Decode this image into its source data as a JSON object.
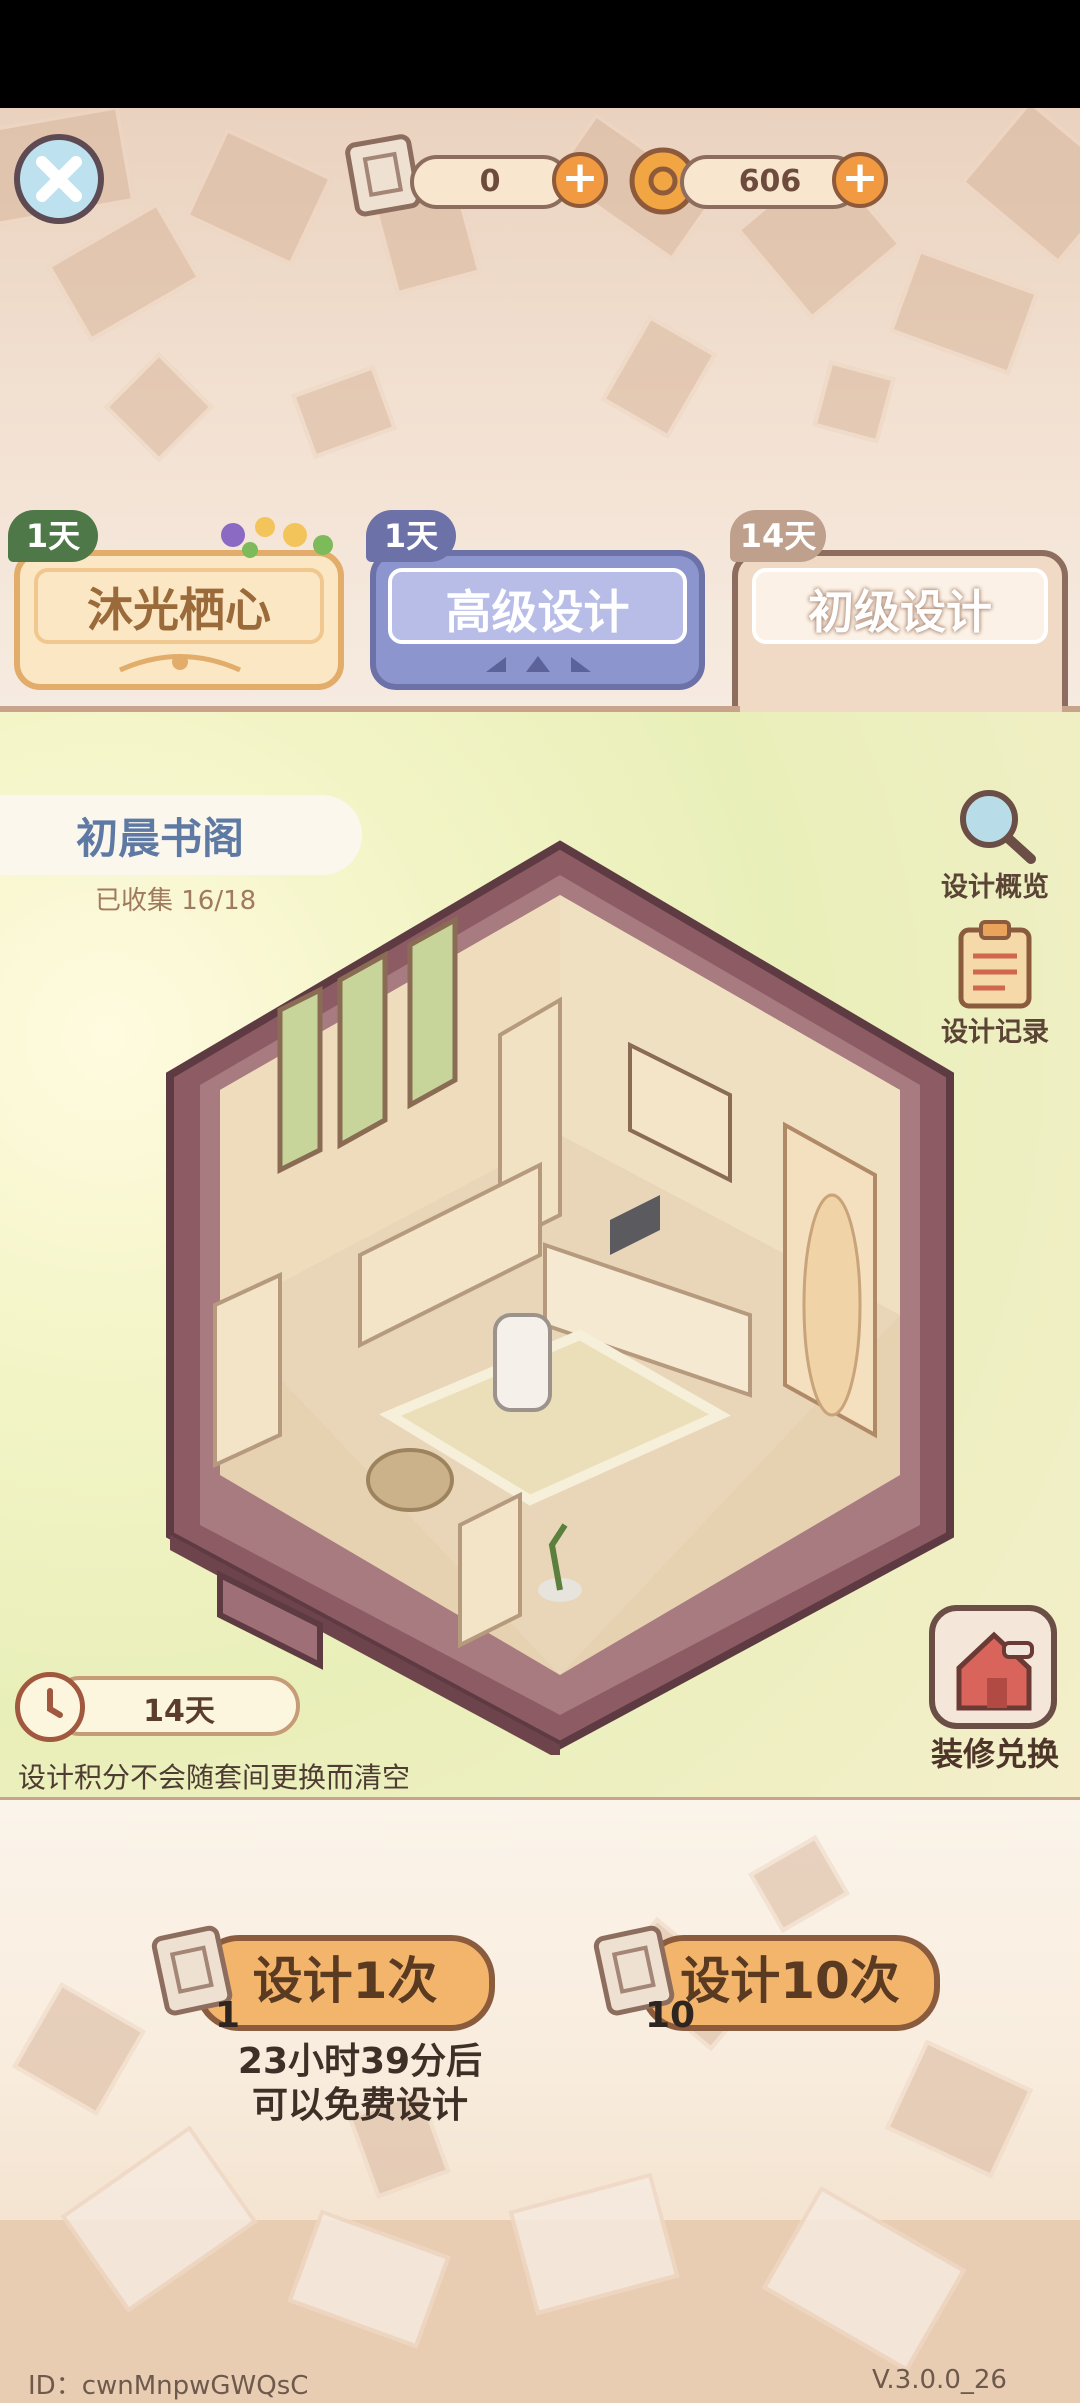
{
  "currency": {
    "scroll_count": "0",
    "coin_count": "606",
    "plus": "+"
  },
  "tabs": [
    {
      "badge": "1天",
      "label": "沐光栖心"
    },
    {
      "badge": "1天",
      "label": "高级设计"
    },
    {
      "badge": "14天",
      "label": "初级设计"
    }
  ],
  "room": {
    "name": "初晨书阁",
    "collected": "已收集 16/18"
  },
  "side_buttons": {
    "overview": "设计概览",
    "record": "设计记录",
    "exchange": "装修兑换"
  },
  "timer": {
    "days": "14天",
    "note": "设计积分不会随套间更换而清空"
  },
  "design": {
    "once_label": "设计1次",
    "once_cost": "1",
    "ten_label": "设计10次",
    "ten_cost": "10",
    "free_line1": "23小时39分后",
    "free_line2": "可以免费设计"
  },
  "footer": {
    "id": "ID：cwnMnpwGWQsC",
    "version": "V.3.0.0_26"
  }
}
